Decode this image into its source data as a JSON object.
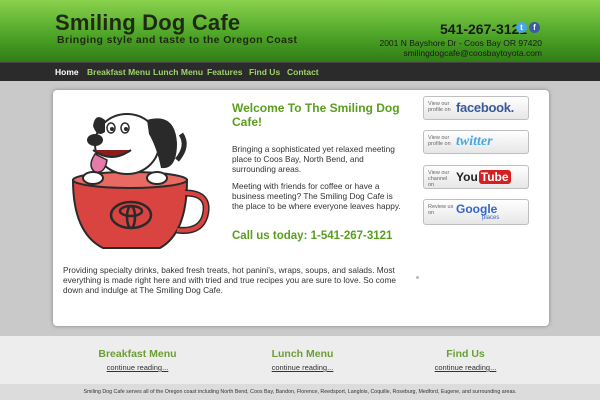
{
  "header": {
    "title": "Smiling Dog Cafe",
    "tagline": "Bringing style and taste to the Oregon Coast",
    "phone": "541-267-3121",
    "address": "2001 N Bayshore Dr - Coos Bay OR 97420",
    "email": "smilingdogcafe@coosbaytoyota.com",
    "mini_icons": [
      "twitter-icon",
      "facebook-icon"
    ]
  },
  "nav": {
    "items": [
      "Home",
      "Breakfast Menu",
      "Lunch Menu",
      "Features",
      "Find Us",
      "Contact"
    ],
    "active": "Home"
  },
  "main": {
    "welcome": "Welcome To The Smiling Dog Cafe!",
    "para1": "Bringing a sophisticated yet relaxed meeting place to Coos Bay, North Bend, and surrounding areas.",
    "para2": "Meeting with friends for coffee or have a business meeting? The Smiling Dog Cafe is the place to be where everyone leaves happy.",
    "call": "Call us today: 1-541-267-3121",
    "bottom": "Providing specialty drinks, baked fresh treats, hot panini's, wraps, soups, and salads. Most everything is made right here and with tried and true recipes you are sure to love. So come down and indulge at The Smiling Dog Cafe."
  },
  "social": {
    "facebook": {
      "small": "View our profile on",
      "logo": "facebook."
    },
    "twitter": {
      "small": "View our profile on",
      "logo": "twitter"
    },
    "youtube": {
      "small": "View our channel on",
      "logo_you": "You",
      "logo_tube": "Tube"
    },
    "google": {
      "small": "Review us on",
      "logo": "Google",
      "logo_sub": "places"
    }
  },
  "footer": {
    "columns": [
      {
        "title": "Breakfast Menu",
        "link": "continue reading..."
      },
      {
        "title": "Lunch Menu",
        "link": "continue reading..."
      },
      {
        "title": "Find Us",
        "link": "continue reading..."
      }
    ],
    "copyright": "Smiling Dog Cafe serves all of the Oregon coast including North Bend, Coos Bay, Bandon, Florence, Reedsport, Langlois, Coquille, Roseburg, Medford, Eugene, and surrounding areas."
  },
  "colors": {
    "brand_green": "#5a9e1e",
    "header_green": "#4fa628",
    "nav_bg": "#2b2b2b",
    "cup_red": "#d94440"
  }
}
